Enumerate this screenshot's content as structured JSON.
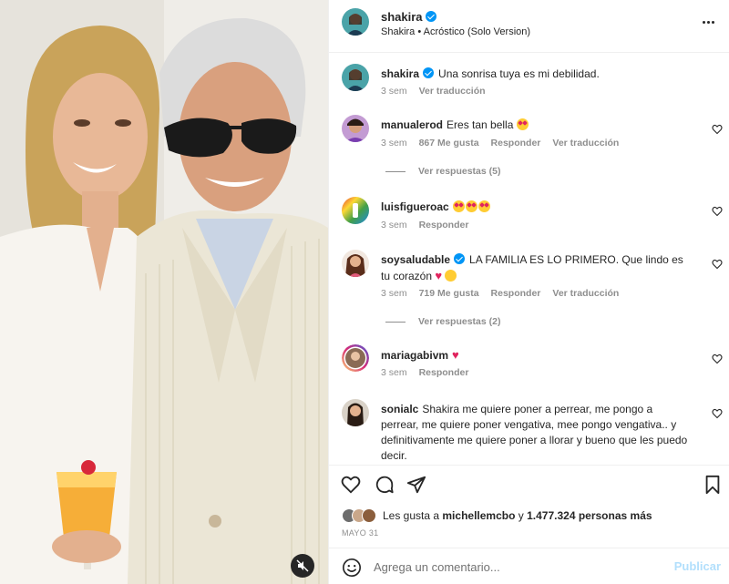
{
  "post": {
    "username": "shakira",
    "audio": "Shakira • Acróstico (Solo Version)",
    "caption": "Una sonrisa tuya es mi debilidad.",
    "caption_time": "3 sem",
    "translate_label": "Ver traducción"
  },
  "comments": [
    {
      "username": "manualerod",
      "text": "Eres tan bella",
      "time": "3 sem",
      "likes": "867 Me gusta",
      "reply": "Responder",
      "translate": "Ver traducción",
      "replies": "Ver respuestas (5)"
    },
    {
      "username": "luisfigueroac",
      "text": "",
      "time": "3 sem",
      "reply": "Responder"
    },
    {
      "username": "soysaludable",
      "text": "LA FAMILIA ES LO PRIMERO. Que lindo es tu corazón",
      "time": "3 sem",
      "likes": "719 Me gusta",
      "reply": "Responder",
      "translate": "Ver traducción",
      "replies": "Ver respuestas (2)"
    },
    {
      "username": "mariagabivm",
      "text": "",
      "time": "3 sem",
      "reply": "Responder"
    },
    {
      "username": "sonialc",
      "text": "Shakira me quiere poner a perrear, me pongo a perrear, me quiere poner vengativa, mee pongo vengativa.. y definitivamente me quiere poner a llorar y bueno que les puedo decir."
    }
  ],
  "likes": {
    "prefix": "Les gusta a",
    "user": "michellemcbo",
    "conj": "y",
    "others": "1.477.324 personas más"
  },
  "date": "MAYO 31",
  "comment_input": {
    "placeholder": "Agrega un comentario..."
  },
  "publish_label": "Publicar",
  "icons": {
    "header_more": "more-horizontal-icon",
    "like": "heart-outline-icon",
    "comment": "comment-bubble-icon",
    "share": "paper-plane-icon",
    "save": "bookmark-icon",
    "mute": "speaker-muted-icon",
    "emoji": "smiley-icon"
  },
  "colors": {
    "verified": "#0095f6",
    "link_muted": "#8e8e8e",
    "publish_disabled": "#b2dffc"
  }
}
